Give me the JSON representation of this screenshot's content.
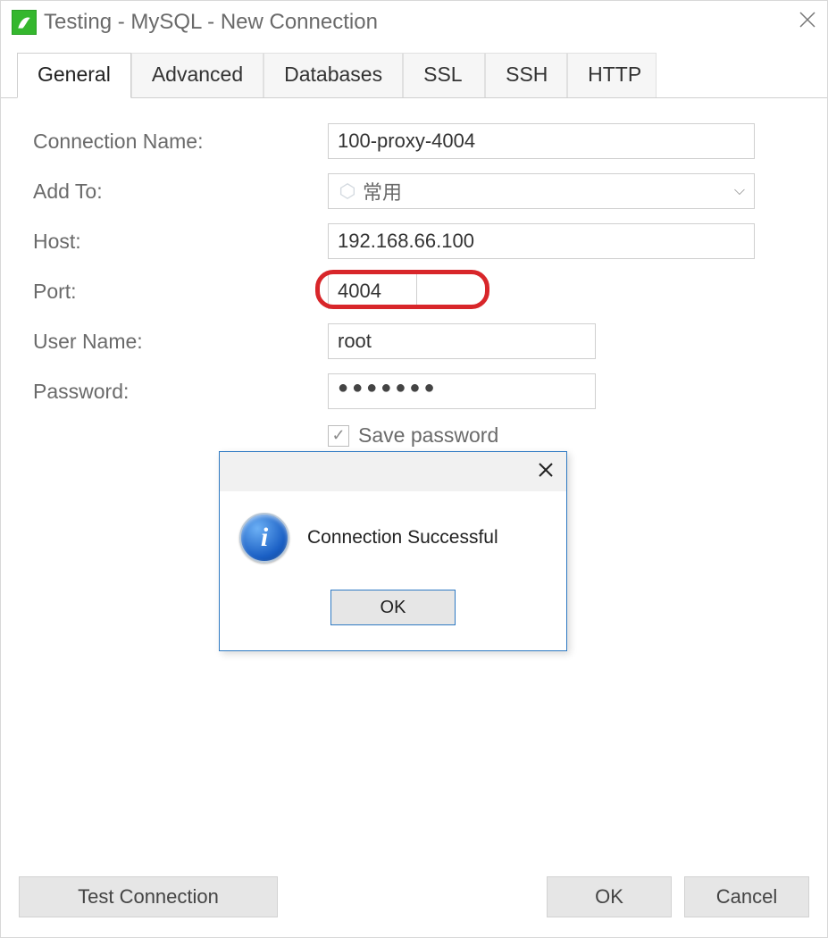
{
  "window": {
    "title": "Testing - MySQL - New Connection"
  },
  "tabs": {
    "general": "General",
    "advanced": "Advanced",
    "databases": "Databases",
    "ssl": "SSL",
    "ssh": "SSH",
    "http": "HTTP",
    "active": "general"
  },
  "form": {
    "labels": {
      "connection_name": "Connection Name:",
      "add_to": "Add To:",
      "host": "Host:",
      "port": "Port:",
      "user_name": "User Name:",
      "password": "Password:"
    },
    "values": {
      "connection_name": "100-proxy-4004",
      "add_to": "常用",
      "host": "192.168.66.100",
      "port": "4004",
      "user_name": "root",
      "password_mask": "●●●●●●●"
    },
    "save_password": {
      "label": "Save password",
      "checked": true
    }
  },
  "footer": {
    "test_connection": "Test Connection",
    "ok": "OK",
    "cancel": "Cancel"
  },
  "modal": {
    "message": "Connection Successful",
    "ok": "OK"
  }
}
